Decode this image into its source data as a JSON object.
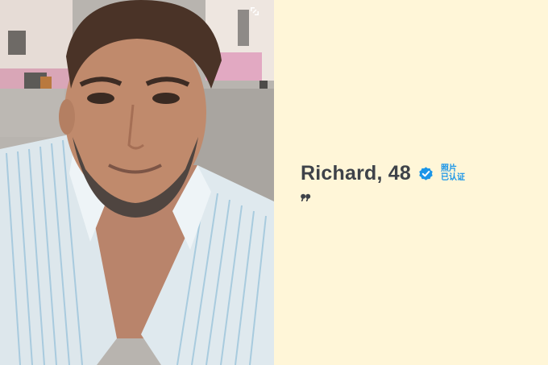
{
  "profile": {
    "name_age": "Richard, 48",
    "verified_line1": "照片",
    "verified_line2": "已认证"
  },
  "icons": {
    "verified": "verified-badge-icon",
    "expand": "expand-photo-icon",
    "quote": "quote-icon"
  },
  "colors": {
    "background": "#fff6d8",
    "name_text": "#3e4249",
    "verified_blue": "#1a95e8"
  }
}
